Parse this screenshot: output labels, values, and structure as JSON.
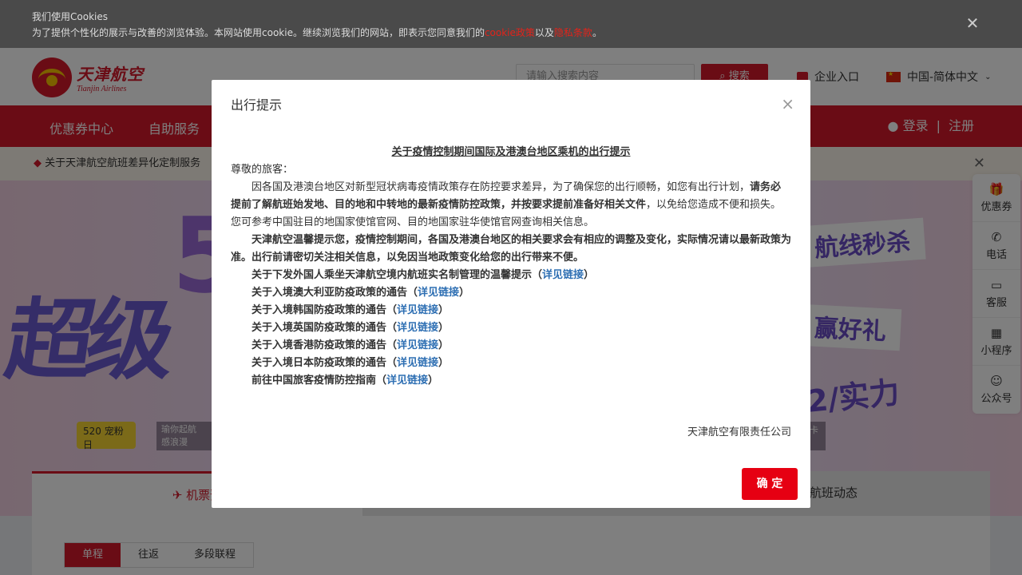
{
  "cookie": {
    "title": "我们使用Cookies",
    "text_before": "为了提供个性化的展示与改善的浏览体验。本网站使用cookie。继续浏览我们的网站，即表示您同意我们的",
    "link1": "cookie政策",
    "text_mid": "以及",
    "link2": "隐私条款",
    "text_after": "。"
  },
  "header": {
    "logo_cn": "天津航空",
    "logo_en": "Tianjin Airlines",
    "search_placeholder": "请输入搜索内容",
    "search_btn": "搜索",
    "enterprise": "企业入口",
    "lang": "中国-简体中文"
  },
  "nav": {
    "items": [
      "优惠券中心",
      "自助服务"
    ],
    "login": "登录",
    "sep": "|",
    "register": "注册"
  },
  "notice": {
    "text": "关于天津航空航班差异化定制服务"
  },
  "banner": {
    "big_text": "超级",
    "five": "5",
    "tag1": "航线秒杀",
    "tag2": "赢好礼",
    "tag3": "2/实力",
    "promo_pill": "520 宠粉日",
    "promo_dark": "瑜你起航 感浪漫",
    "promo_dark2": "卡"
  },
  "booking": {
    "tab_flight": "机票预",
    "tab_status": "航班动态",
    "trip_types": [
      "单程",
      "往返",
      "多段联程"
    ]
  },
  "rail": {
    "items": [
      {
        "label": "优惠券",
        "icon": "🎁"
      },
      {
        "label": "电话",
        "icon": "✆"
      },
      {
        "label": "客服",
        "icon": "▭"
      },
      {
        "label": "小程序",
        "icon": "▦"
      },
      {
        "label": "公众号",
        "icon": "☺"
      }
    ]
  },
  "modal": {
    "title": "出行提示",
    "close": "×",
    "heading": "关于疫情控制期间国际及港澳台地区乘机的出行提示",
    "greeting": "尊敬的旅客：",
    "p1_a": "因各国及港澳台地区对新型冠状病毒疫情政策存在防控要求差异，为了确保您的出行顺畅，如您有出行计划，",
    "p1_b": "请务必提前了解航班始发地、目的地和中转地的最新疫情防控政策，并按要求提前准备好相关文件",
    "p1_c": "，以免给您造成不便和损失。您可参考中国驻目的地国家使馆官网、目的地国家驻华使馆官网查询相关信息。",
    "p2": "天津航空温馨提示您，疫情控制期间，各国及港澳台地区的相关要求会有相应的调整及变化，实际情况请以最新政策为准。出行前请密切关注相关信息，以免因当地政策变化给您的出行带来不便。",
    "links": [
      {
        "text": "关于下发外国人乘坐天津航空境内航班实名制管理的温馨提示",
        "link": "详见链接"
      },
      {
        "text": "关于入境澳大利亚防疫政策的通告",
        "link": "详见链接"
      },
      {
        "text": "关于入境韩国防疫政策的通告",
        "link": "详见链接"
      },
      {
        "text": "关于入境英国防疫政策的通告",
        "link": "详见链接"
      },
      {
        "text": "关于入境香港防疫政策的通告",
        "link": "详见链接"
      },
      {
        "text": "关于入境日本防疫政策的通告",
        "link": "详见链接"
      },
      {
        "text": "前往中国旅客疫情防控指南",
        "link": "详见链接"
      }
    ],
    "company": "天津航空有限责任公司",
    "ok": "确 定"
  }
}
